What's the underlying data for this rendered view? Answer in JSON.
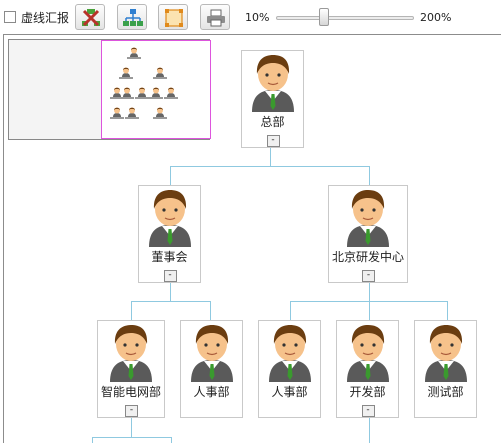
{
  "toolbar": {
    "dashed_report_label": "虚线汇报",
    "buttons": [
      {
        "name": "layout-reset-button",
        "icon": "tree-cross-icon"
      },
      {
        "name": "org-tree-button",
        "icon": "hierarchy-icon"
      },
      {
        "name": "fit-view-button",
        "icon": "fit-frame-icon"
      },
      {
        "name": "print-button",
        "icon": "printer-icon"
      }
    ],
    "zoom": {
      "min_label": "10%",
      "max_label": "200%",
      "level_fraction": 0.33
    }
  },
  "chart": {
    "root": {
      "label": "总部",
      "toggle": "-"
    },
    "level1": [
      {
        "label": "董事会",
        "toggle": "-"
      },
      {
        "label": "北京研发中心",
        "toggle": "-"
      }
    ],
    "level2": [
      {
        "label": "智能电网部",
        "toggle": "-"
      },
      {
        "label": "人事部",
        "toggle": ""
      },
      {
        "label": "人事部",
        "toggle": ""
      },
      {
        "label": "开发部",
        "toggle": "-"
      },
      {
        "label": "测试部",
        "toggle": ""
      }
    ]
  },
  "colors": {
    "connector": "#8fc9e0",
    "minimap_viewport": "#dd55dd",
    "avatar_hair": "#6b3d10",
    "avatar_tie": "#3a9a2e"
  }
}
